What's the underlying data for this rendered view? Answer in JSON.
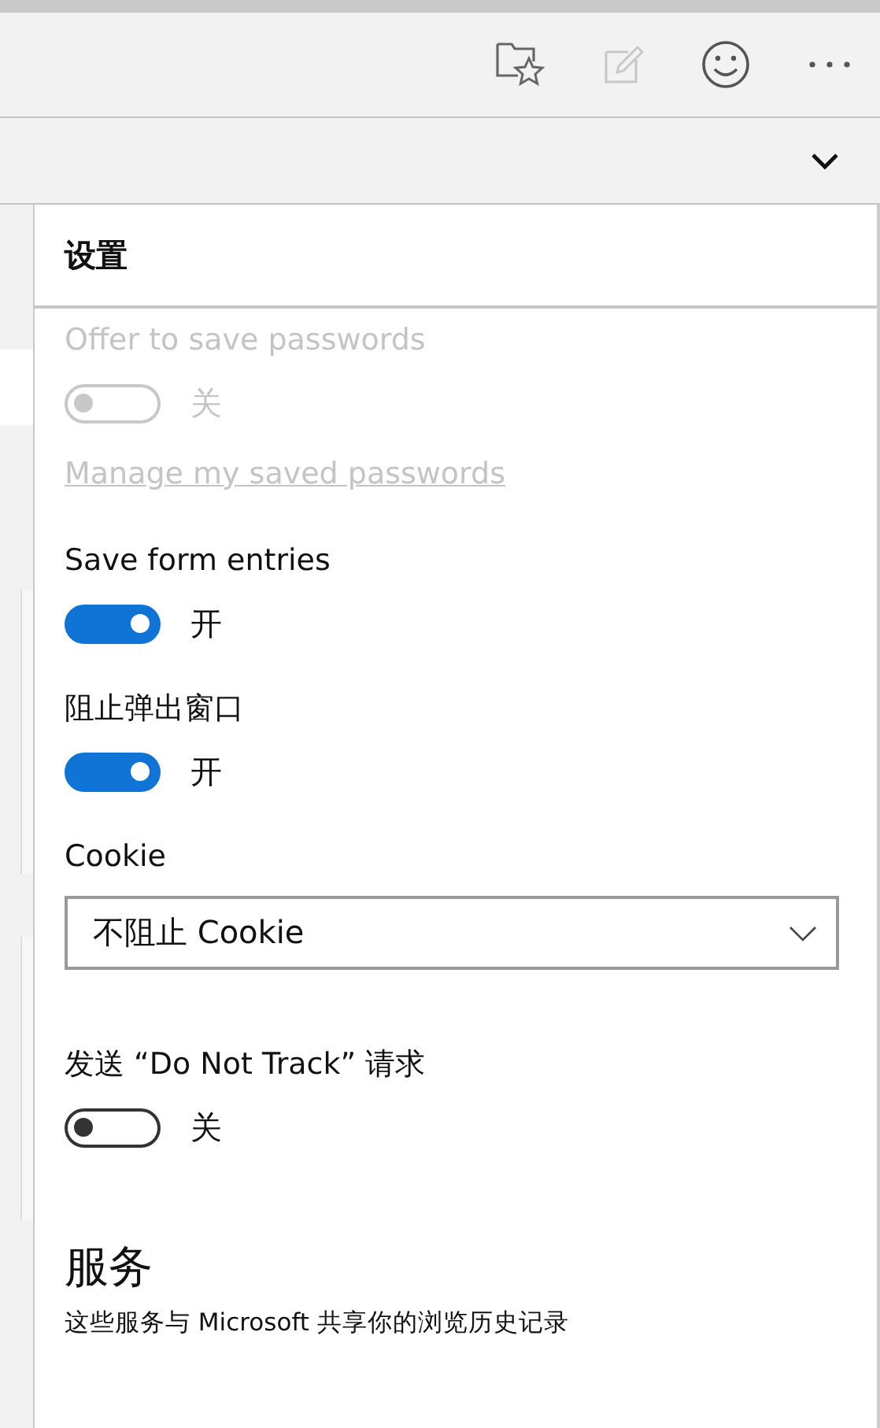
{
  "panel": {
    "title": "设置"
  },
  "settings": [
    {
      "kind": "toggle",
      "label": "Offer to save passwords",
      "on": false,
      "disabled": true,
      "state_text": "关"
    },
    {
      "kind": "link",
      "label": "Manage my saved passwords",
      "disabled": true
    },
    {
      "kind": "toggle",
      "label": "Save form entries",
      "on": true,
      "disabled": false,
      "state_text": "开"
    },
    {
      "kind": "toggle",
      "label": "阻止弹出窗口",
      "on": true,
      "disabled": false,
      "state_text": "开"
    },
    {
      "kind": "dropdown",
      "label": "Cookie",
      "value": "不阻止 Cookie"
    },
    {
      "kind": "toggle",
      "label": "发送 “Do Not Track” 请求",
      "on": false,
      "disabled": false,
      "state_text": "关"
    },
    {
      "kind": "section",
      "label": "服务",
      "description": "这些服务与 Microsoft 共享你的浏览历史记录"
    }
  ]
}
